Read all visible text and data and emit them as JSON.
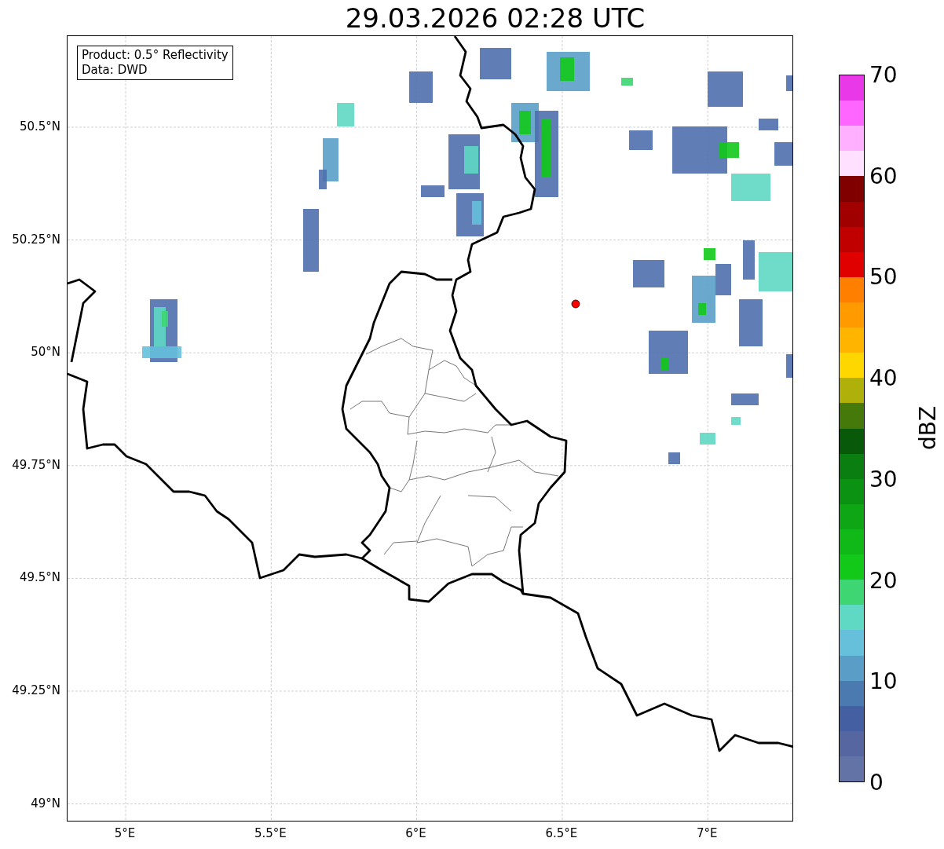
{
  "title": "29.03.2026 02:28 UTC",
  "map": {
    "legend": [
      "Product: 0.5° Reflectivity",
      "Data: DWD"
    ],
    "yticks": [
      "50.5°N",
      "50.25°N",
      "50°N",
      "49.75°N",
      "49.5°N",
      "49.25°N",
      "49°N"
    ],
    "xticks": [
      "5°E",
      "5.5°E",
      "6°E",
      "6.5°E",
      "7°E"
    ]
  },
  "colorbar": {
    "label": "dBZ",
    "ticks": [
      "70",
      "60",
      "50",
      "40",
      "30",
      "20",
      "10",
      "0"
    ],
    "bins": [
      {
        "color": "#e838e8"
      },
      {
        "color": "#ff66ff"
      },
      {
        "color": "#ffb0ff"
      },
      {
        "color": "#ffe0ff"
      },
      {
        "color": "#800000"
      },
      {
        "color": "#a00000"
      },
      {
        "color": "#c00000"
      },
      {
        "color": "#e00000"
      },
      {
        "color": "#ff7f00"
      },
      {
        "color": "#ff9b00"
      },
      {
        "color": "#ffb400"
      },
      {
        "color": "#ffd700"
      },
      {
        "color": "#b0b00a"
      },
      {
        "color": "#457a0a"
      },
      {
        "color": "#085a0a"
      },
      {
        "color": "#0a7e10"
      },
      {
        "color": "#0c9212"
      },
      {
        "color": "#0ea614"
      },
      {
        "color": "#10b818"
      },
      {
        "color": "#12c91a"
      },
      {
        "color": "#3dd672"
      },
      {
        "color": "#5fd8c4"
      },
      {
        "color": "#66c0dc"
      },
      {
        "color": "#5a9ec8"
      },
      {
        "color": "#4a7ab0"
      },
      {
        "color": "#4560a2"
      },
      {
        "color": "#5566a0"
      },
      {
        "color": "#6473a6"
      }
    ]
  }
}
